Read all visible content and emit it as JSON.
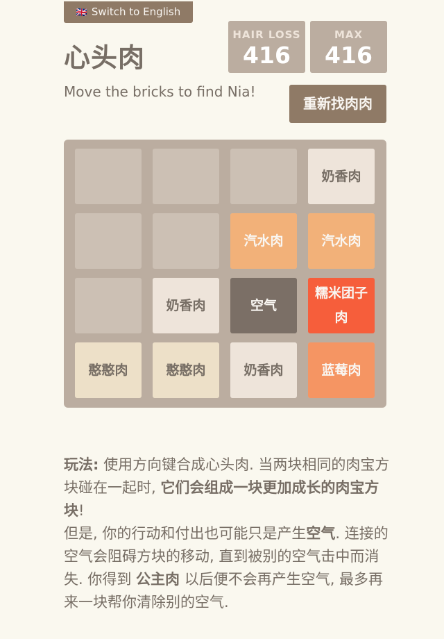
{
  "header": {
    "language_button": {
      "flag": "🇬🇧",
      "label": "Switch to English"
    },
    "title": "心头肉",
    "subtitle": "Move the bricks to find Nia!",
    "new_game_label": "重新找肉肉"
  },
  "scores": {
    "hair_loss": {
      "label": "HAIR LOSS",
      "value": "416"
    },
    "max": {
      "label": "MAX",
      "value": "416"
    }
  },
  "board": {
    "tiles": [
      {
        "row": 1,
        "col": 4,
        "label": "奶香肉",
        "kind": "nai"
      },
      {
        "row": 2,
        "col": 3,
        "label": "汽水肉",
        "kind": "qi-shui"
      },
      {
        "row": 2,
        "col": 4,
        "label": "汽水肉",
        "kind": "qi-shui"
      },
      {
        "row": 3,
        "col": 2,
        "label": "奶香肉",
        "kind": "nai"
      },
      {
        "row": 3,
        "col": 3,
        "label": "空气",
        "kind": "kongqi"
      },
      {
        "row": 3,
        "col": 4,
        "label": "糯米团子肉",
        "kind": "nuomi"
      },
      {
        "row": 4,
        "col": 1,
        "label": "憨憨肉",
        "kind": "hanhan"
      },
      {
        "row": 4,
        "col": 2,
        "label": "憨憨肉",
        "kind": "hanhan"
      },
      {
        "row": 4,
        "col": 3,
        "label": "奶香肉",
        "kind": "nai"
      },
      {
        "row": 4,
        "col": 4,
        "label": "蓝莓肉",
        "kind": "lanmei"
      }
    ]
  },
  "rules": {
    "p1": "玩法:",
    "p2": " 使用方向键合成心头肉. 当两块相同的肉宝方块碰在一起时, ",
    "p3": "它们会组成一块更加成长的肉宝方块",
    "p4": "!",
    "p5": "但是, 你的行动和付出也可能只是产生",
    "p6": "空气",
    "p7": ". 连接的空气会阻碍方块的移动, 直到被别的空气击中而消失. 你得到 ",
    "p8": "公主肉",
    "p9": " 以后便不会再产生空气, 最多再来一块帮你清除别的空气."
  },
  "colors": {
    "background": "#faf8ef",
    "board": "#bbada0",
    "button": "#8f7a66",
    "text": "#776e65"
  }
}
